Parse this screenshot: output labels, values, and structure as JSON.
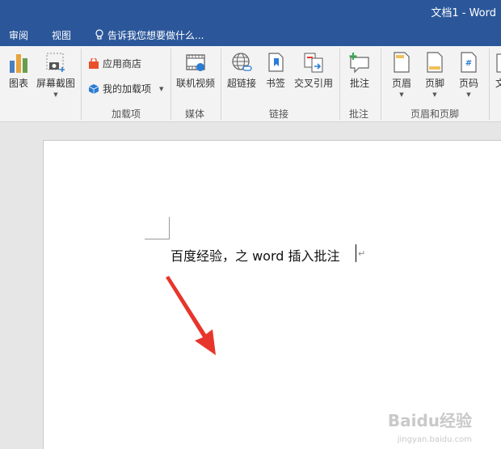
{
  "window": {
    "title": "文档1 - Word"
  },
  "tabs": {
    "review": "审阅",
    "view": "视图"
  },
  "tell_me": {
    "text": "告诉我您想要做什么..."
  },
  "ribbon": {
    "chart": "图表",
    "screenshot": "屏幕截图",
    "store": "应用商店",
    "my_addins": "我的加载项",
    "addins_group": "加载项",
    "online_video": "联机视频",
    "media_group": "媒体",
    "hyperlink": "超链接",
    "bookmark": "书签",
    "cross_reference": "交叉引用",
    "links_group": "链接",
    "comment": "批注",
    "comments_group": "批注",
    "header": "页眉",
    "footer": "页脚",
    "page_number": "页码",
    "header_footer_group": "页眉和页脚",
    "textbox_partial": "文"
  },
  "document": {
    "text": "百度经验，之 word 插入批注"
  },
  "watermark": {
    "brand": "Baidu经验",
    "site": "jingyan.baidu.com"
  },
  "colors": {
    "accent": "#2b579a",
    "arrow": "#e8352b"
  }
}
